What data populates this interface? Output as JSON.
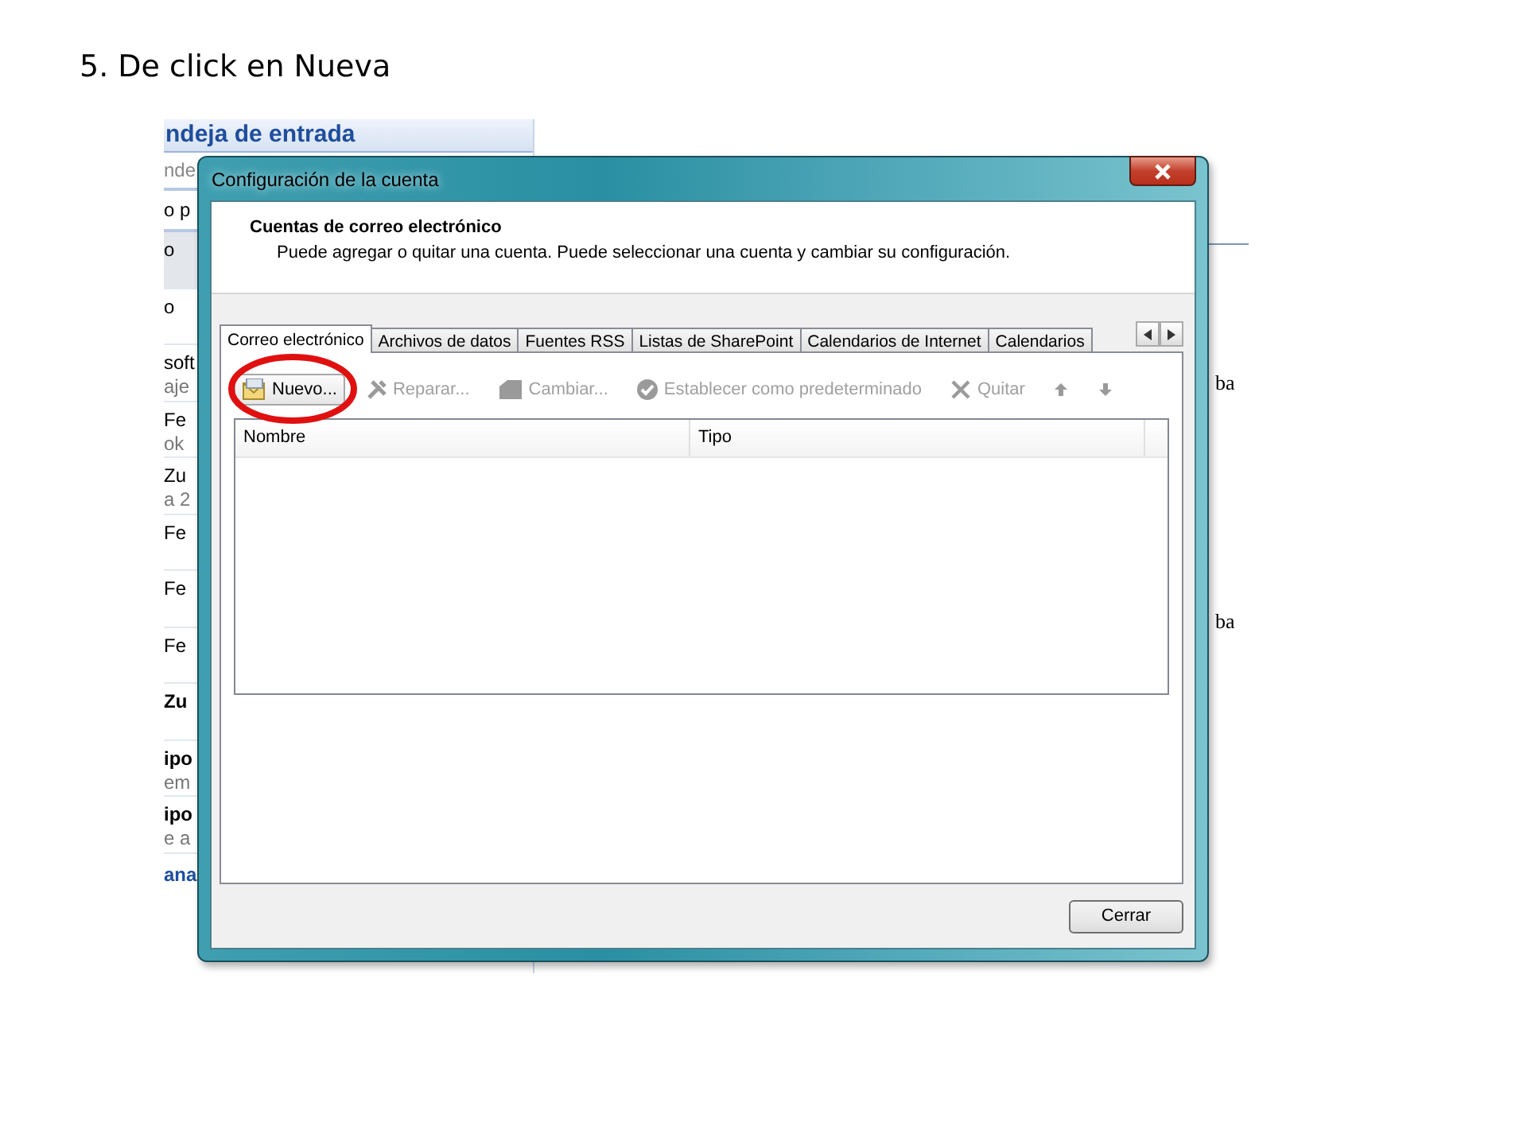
{
  "slide_title": "5. De click en Nueva",
  "background_window": {
    "header": "ndeja de entrada",
    "search_fragment": "nde",
    "filter_fragment": "o p",
    "rows": [
      {
        "lines": [
          "o"
        ],
        "bold": false,
        "selected": true
      },
      {
        "lines": [
          "o"
        ],
        "bold": false,
        "selected": false
      },
      {
        "lines": [
          "soft",
          "aje"
        ],
        "bold": false,
        "selected": false
      },
      {
        "lines": [
          "Fe",
          "ok"
        ],
        "bold": false,
        "selected": false
      },
      {
        "lines": [
          "Zu",
          "a 2"
        ],
        "bold": false,
        "selected": false
      },
      {
        "lines": [
          "Fe"
        ],
        "bold": false,
        "selected": false
      },
      {
        "lines": [
          "Fe"
        ],
        "bold": false,
        "selected": false
      },
      {
        "lines": [
          "Fe"
        ],
        "bold": false,
        "selected": false
      },
      {
        "lines": [
          "Zu"
        ],
        "bold": true,
        "selected": false
      },
      {
        "lines": [
          "ipo",
          "em"
        ],
        "bold": true,
        "selected": false
      },
      {
        "lines": [
          "ipo",
          "e a"
        ],
        "bold": true,
        "selected": false
      }
    ],
    "footer_fragment": "ana",
    "right_fragments": [
      "ba",
      "ba"
    ]
  },
  "dialog": {
    "title": "Configuración de la cuenta",
    "heading": "Cuentas de correo electrónico",
    "description": "Puede agregar o quitar una cuenta. Puede seleccionar una cuenta y cambiar su configuración.",
    "tabs": [
      {
        "label": "Correo electrónico",
        "selected": true
      },
      {
        "label": "Archivos de datos",
        "selected": false
      },
      {
        "label": "Fuentes RSS",
        "selected": false
      },
      {
        "label": "Listas de SharePoint",
        "selected": false
      },
      {
        "label": "Calendarios de Internet",
        "selected": false
      },
      {
        "label": "Calendarios",
        "selected": false
      }
    ],
    "toolbar": [
      {
        "kind": "new",
        "label": "Nuevo...",
        "disabled": false
      },
      {
        "kind": "repair",
        "label": "Reparar...",
        "disabled": true
      },
      {
        "kind": "change",
        "label": "Cambiar...",
        "disabled": true
      },
      {
        "kind": "default",
        "label": "Establecer como predeterminado",
        "disabled": true
      },
      {
        "kind": "remove",
        "label": "Quitar",
        "disabled": true
      },
      {
        "kind": "up",
        "disabled": true
      },
      {
        "kind": "down",
        "disabled": true
      }
    ],
    "table": {
      "columns": [
        "Nombre",
        "Tipo"
      ]
    },
    "close_button": "Cerrar"
  }
}
